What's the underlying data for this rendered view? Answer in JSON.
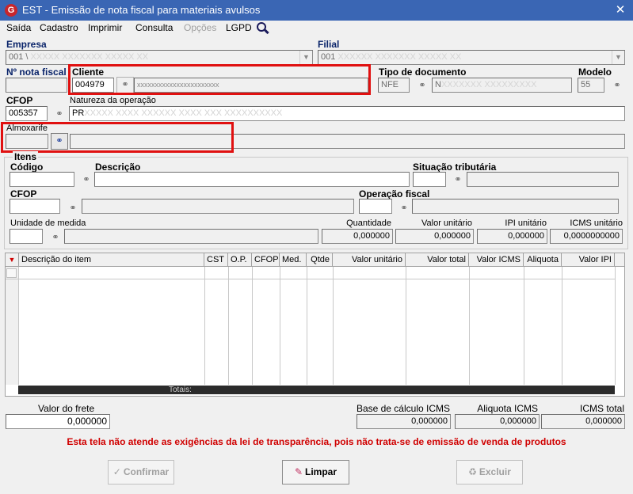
{
  "window": {
    "title": "EST - Emissão de nota fiscal para materiais avulsos",
    "app_icon_letter": "G",
    "close_glyph": "✕"
  },
  "menu": {
    "items": [
      "Saída",
      "Cadastro",
      "Imprimir",
      "Consulta",
      "Opções",
      "LGPD"
    ]
  },
  "empresa": {
    "label": "Empresa",
    "value": "001 \\ ",
    "hidden": "XXXXX XXXXXXX XXXXX XX"
  },
  "filial": {
    "label": "Filial",
    "value": "001 ",
    "hidden": "XXXXXX XXXXXXX XXXXX XX"
  },
  "nota_fiscal": {
    "label": "Nº nota fiscal",
    "value": ""
  },
  "cliente": {
    "label": "Cliente",
    "code": "004979",
    "name": "xxxxxxxxxxxxxxxxxxxxxxx"
  },
  "tipo_documento": {
    "label": "Tipo de documento",
    "code": "NFE",
    "desc": "N",
    "hidden": "XXXXXXX XXXXXXXXX"
  },
  "modelo": {
    "label": "Modelo",
    "value": "55"
  },
  "cfop": {
    "label": "CFOP",
    "value": "005357"
  },
  "natureza": {
    "label": "Natureza da operação",
    "value": "PR",
    "hidden": "XXXXX XXXX XXXXXX XXXX XXX XXXXXXXXXX"
  },
  "almoxarife": {
    "label": "Almoxarife",
    "code": "",
    "name": ""
  },
  "itens": {
    "group_label": "Itens",
    "codigo_label": "Código",
    "codigo_value": "",
    "descricao_label": "Descrição",
    "descricao_value": "",
    "situacao_label": "Situação tributária",
    "situacao_value": "",
    "cfop_label": "CFOP",
    "cfop_value": "",
    "operacao_label": "Operação fiscal",
    "operacao_value": "",
    "unidade_label": "Unidade de medida",
    "unidade_value": "",
    "quantidade_label": "Quantidade",
    "quantidade_value": "0,000000",
    "valor_unitario_label": "Valor unitário",
    "valor_unitario_value": "0,000000",
    "ipi_unitario_label": "IPI unitário",
    "ipi_unitario_value": "0,000000",
    "icms_unitario_label": "ICMS unitário",
    "icms_unitario_value": "0,0000000000"
  },
  "grid": {
    "columns": [
      "Descrição do item",
      "CST",
      "O.P.",
      "CFOP",
      "Med.",
      "Qtde",
      "Valor unitário",
      "Valor total",
      "Valor ICMS",
      "Aliquota",
      "Valor IPI"
    ],
    "totals_label": "Totais:"
  },
  "footer": {
    "valor_frete_label": "Valor do frete",
    "valor_frete_value": "0,000000",
    "base_icms_label": "Base de cálculo ICMS",
    "base_icms_value": "0,000000",
    "aliquota_icms_label": "Aliquota ICMS",
    "aliquota_icms_value": "0,000000",
    "icms_total_label": "ICMS total",
    "icms_total_value": "0,000000"
  },
  "message": "Esta tela não atende as exigências da lei de transparência, pois não trata-se de emissão de venda de produtos",
  "buttons": {
    "confirmar": "Confirmar",
    "limpar": "Limpar",
    "excluir": "Excluir"
  },
  "colors": {
    "titlebar": "#3a66b4",
    "highlight": "#e01010",
    "message": "#d00000",
    "label_navy": "#0a246a"
  }
}
